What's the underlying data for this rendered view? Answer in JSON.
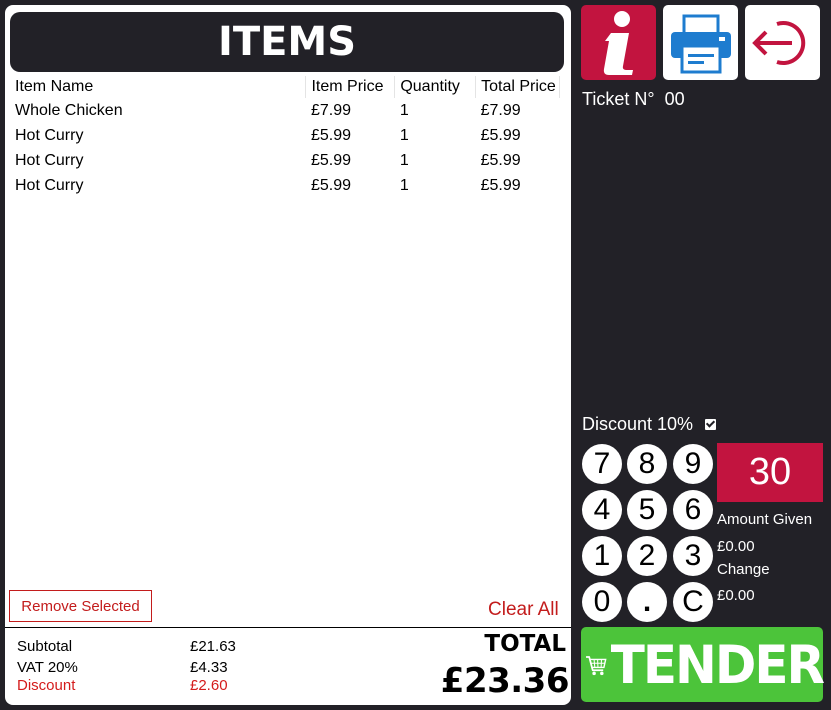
{
  "header": {
    "title": "ITEMS"
  },
  "table": {
    "columns": [
      "Item Name",
      "Item Price",
      "Quantity",
      "Total Price"
    ],
    "rows": [
      {
        "name": "Whole Chicken",
        "price": "£7.99",
        "qty": "1",
        "total": "£7.99"
      },
      {
        "name": "Hot Curry",
        "price": "£5.99",
        "qty": "1",
        "total": "£5.99"
      },
      {
        "name": "Hot Curry",
        "price": "£5.99",
        "qty": "1",
        "total": "£5.99"
      },
      {
        "name": "Hot Curry",
        "price": "£5.99",
        "qty": "1",
        "total": "£5.99"
      }
    ]
  },
  "actions": {
    "remove_selected": "Remove Selected",
    "clear_all": "Clear All"
  },
  "summary": {
    "subtotal_label": "Subtotal",
    "subtotal": "£21.63",
    "vat_label": "VAT 20%",
    "vat": "£4.33",
    "discount_label": "Discount",
    "discount": "£2.60",
    "total_label": "TOTAL",
    "total": "£23.36"
  },
  "toolbar": {
    "info_icon": "info-icon",
    "print_icon": "printer-icon",
    "logout_icon": "logout-icon"
  },
  "ticket": {
    "label": "Ticket N°",
    "number": "00"
  },
  "discount_option": {
    "label": "Discount 10%",
    "checked": true
  },
  "keypad": {
    "keys": [
      "7",
      "8",
      "9",
      "4",
      "5",
      "6",
      "1",
      "2",
      "3",
      "0",
      ".",
      "C"
    ]
  },
  "amount": {
    "display": "30",
    "given_label": "Amount Given",
    "given": "£0.00",
    "change_label": "Change",
    "change": "£0.00"
  },
  "tender": {
    "label": "TENDER",
    "icon": "cart-icon"
  },
  "colors": {
    "accent_red": "#c2143f",
    "tender_green": "#4cc43a",
    "background": "#222127",
    "text_red": "#d41c1c"
  }
}
